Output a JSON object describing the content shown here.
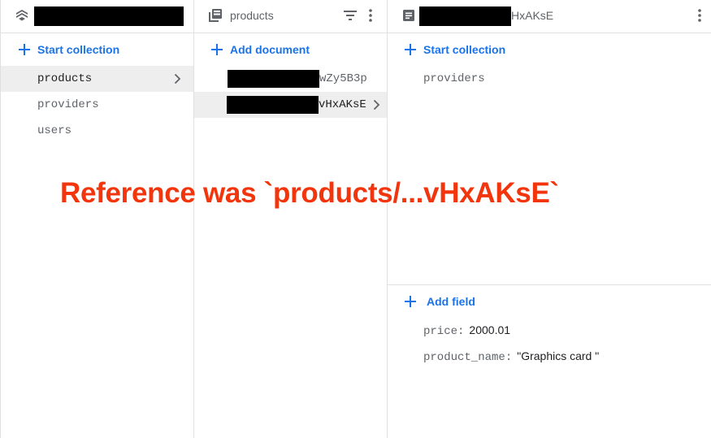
{
  "root_panel": {
    "start_collection_label": "Start collection",
    "collections": [
      {
        "label": "products",
        "selected": true
      },
      {
        "label": "providers",
        "selected": false
      },
      {
        "label": "users",
        "selected": false
      }
    ]
  },
  "collection_panel": {
    "title": "products",
    "add_document_label": "Add document",
    "documents": [
      {
        "label": "wZy5B3p",
        "selected": false
      },
      {
        "label": "vHxAKsE",
        "selected": true
      }
    ]
  },
  "document_panel": {
    "title_suffix": "HxAKsE",
    "start_collection_label": "Start collection",
    "subcollections": [
      {
        "label": "providers"
      }
    ],
    "add_field_label": "Add field",
    "fields": [
      {
        "key": "price:",
        "value": "2000.01"
      },
      {
        "key": "product_name:",
        "value": "\"Graphics card \""
      }
    ]
  },
  "annotation": {
    "text": "Reference was `products/...vHxAKsE`",
    "color": "#f2350c"
  },
  "colors": {
    "accent": "#1a73e8",
    "selected_row": "#eeeeee",
    "divider": "#e0e0e0",
    "muted_text": "#5f6368"
  },
  "icons": {
    "project": "firestore-icon",
    "collection": "collection-icon",
    "document": "document-icon",
    "filter": "filter-icon",
    "more": "more-vert-icon",
    "add": "plus-icon",
    "chevron": "chevron-right-icon"
  }
}
